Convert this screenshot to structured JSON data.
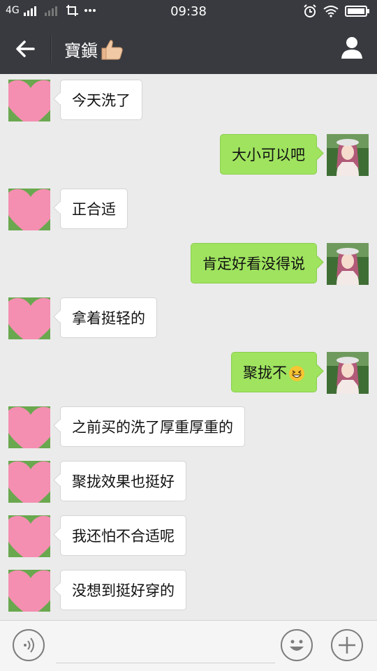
{
  "status_bar": {
    "network": "4G",
    "time": "09:38"
  },
  "header": {
    "title": "寶鎭",
    "title_emoji": "thumbs-up-icon"
  },
  "messages": [
    {
      "side": "left",
      "text": "今天洗了"
    },
    {
      "side": "right",
      "text": "大小可以吧"
    },
    {
      "side": "left",
      "text": "正合适"
    },
    {
      "side": "right",
      "text": "肯定好看没得说"
    },
    {
      "side": "left",
      "text": "拿着挺轻的"
    },
    {
      "side": "right",
      "text": "聚拢不",
      "emoji": "grinning-squint-face-icon"
    },
    {
      "side": "left",
      "text": "之前买的洗了厚重厚重的"
    },
    {
      "side": "left",
      "text": "聚拢效果也挺好"
    },
    {
      "side": "left",
      "text": "我还怕不合适呢"
    },
    {
      "side": "left",
      "text": "没想到挺好穿的"
    }
  ],
  "input_bar": {
    "placeholder": ""
  },
  "colors": {
    "header_bg": "#393a3f",
    "chat_bg": "#ebebeb",
    "sent_bubble": "#9fe35f",
    "received_bubble": "#ffffff",
    "sticker_heart": "#f48fb1"
  }
}
